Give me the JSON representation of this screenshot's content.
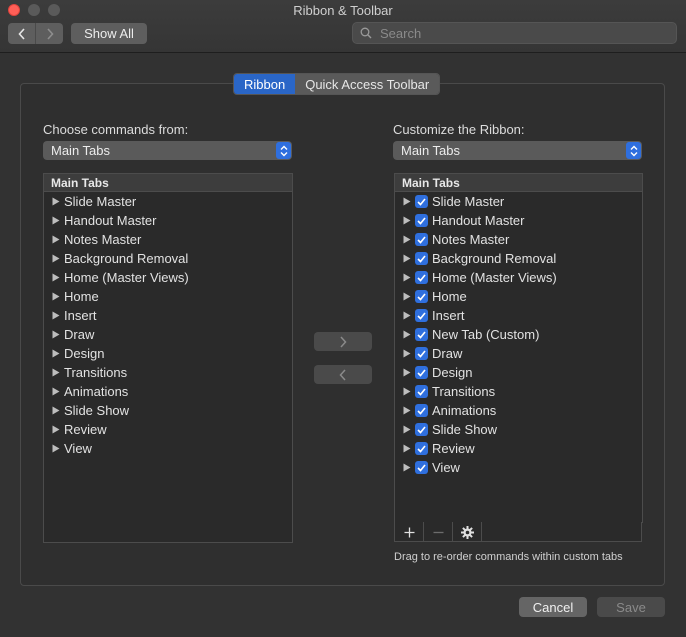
{
  "window": {
    "title": "Ribbon & Toolbar"
  },
  "toolbar": {
    "back_icon": "chevron-left-icon",
    "forward_icon": "chevron-right-icon",
    "show_all_label": "Show All"
  },
  "search": {
    "placeholder": "Search"
  },
  "tabs": [
    {
      "label": "Ribbon",
      "selected": true
    },
    {
      "label": "Quick Access Toolbar",
      "selected": false
    }
  ],
  "left": {
    "label": "Choose commands from:",
    "dropdown_value": "Main Tabs",
    "list_header": "Main Tabs",
    "items": [
      "Slide Master",
      "Handout Master",
      "Notes Master",
      "Background Removal",
      "Home (Master Views)",
      "Home",
      "Insert",
      "Draw",
      "Design",
      "Transitions",
      "Animations",
      "Slide Show",
      "Review",
      "View"
    ]
  },
  "right": {
    "label": "Customize the Ribbon:",
    "dropdown_value": "Main Tabs",
    "list_header": "Main Tabs",
    "items": [
      {
        "label": "Slide Master",
        "checked": true
      },
      {
        "label": "Handout Master",
        "checked": true
      },
      {
        "label": "Notes Master",
        "checked": true
      },
      {
        "label": "Background Removal",
        "checked": true
      },
      {
        "label": "Home (Master Views)",
        "checked": true
      },
      {
        "label": "Home",
        "checked": true
      },
      {
        "label": "Insert",
        "checked": true
      },
      {
        "label": "New Tab (Custom)",
        "checked": true
      },
      {
        "label": "Draw",
        "checked": true
      },
      {
        "label": "Design",
        "checked": true
      },
      {
        "label": "Transitions",
        "checked": true
      },
      {
        "label": "Animations",
        "checked": true
      },
      {
        "label": "Slide Show",
        "checked": true
      },
      {
        "label": "Review",
        "checked": true
      },
      {
        "label": "View",
        "checked": true
      }
    ],
    "hint": "Drag to re-order commands within custom tabs"
  },
  "footer": {
    "cancel_label": "Cancel",
    "save_label": "Save"
  },
  "colors": {
    "accent": "#2f6fde",
    "close": "#ff5f57"
  }
}
